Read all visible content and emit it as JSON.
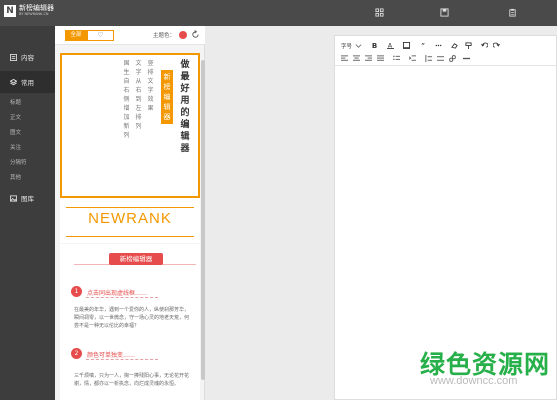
{
  "app": {
    "logo_mark": "N",
    "logo_name": "新榜编辑器",
    "logo_sub": "BY NEWRANK.CN"
  },
  "topbar": {
    "icons": [
      "grid-icon",
      "save-icon",
      "clipboard-icon"
    ]
  },
  "sidebar": {
    "content_label": "内容",
    "common_label": "常用",
    "sub_items": [
      "标题",
      "正文",
      "图文",
      "关注",
      "分隔符",
      "其他"
    ],
    "gallery_label": "图库"
  },
  "panel": {
    "tab_all": "全部",
    "tab_fav": "♡",
    "theme_label": "主题色："
  },
  "template1": {
    "title": "做最好用的编辑器",
    "badge": "新榜编辑器",
    "lines": [
      "竖排文字效果",
      "文字从右到左排列",
      "国生自右侧增加新列"
    ]
  },
  "template2": {
    "text": "NEWRANK"
  },
  "template3": {
    "title": "新榜编辑器",
    "sec1_num": "1",
    "sec1_title": "点击同出现虚线框……",
    "sec1_text": "在最美的年华，遇到一个爱你的人，纵使刹那芳华，瞬间凋零，以一世微念，守一场心灵的地老天荒，何尝不是一种无以伦比的幸福？",
    "sec2_num": "2",
    "sec2_title": "颜色可单独变……",
    "sec2_text": "三千烦嗔，只为一人，掬一捧残阳心事，无论花开花谢，情，都亦以一析执念，向烂成灵魂的永恒。"
  },
  "editor": {
    "font_label": "字号",
    "row1_icons": [
      "bold-icon",
      "font-color-icon",
      "bg-color-icon",
      "quote-icon",
      "more-icon",
      "eraser-icon",
      "format-brush-icon",
      "undo-icon",
      "redo-icon"
    ],
    "row2_icons": [
      "align-left-icon",
      "align-center-icon",
      "align-right-icon",
      "justify-icon",
      "list-icon",
      "indent-icon",
      "line-height-icon",
      "spacing-icon",
      "link-icon",
      "divider-icon"
    ]
  },
  "watermark": {
    "cn": "绿色资源网",
    "url": "www.downcc.com"
  },
  "colors": {
    "accent": "#f39800",
    "theme": "#e64c4c",
    "sidebar": "#3d3d3d",
    "topbar": "#4a4a4a"
  }
}
